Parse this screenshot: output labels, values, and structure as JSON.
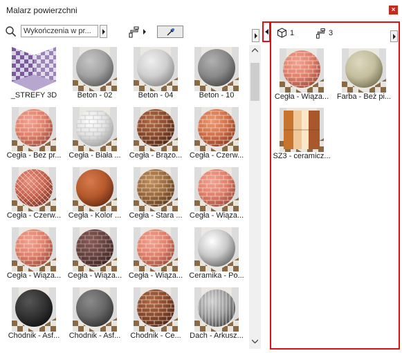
{
  "window": {
    "title": "Malarz powierzchni",
    "close_glyph": "×"
  },
  "toolbar": {
    "search_value": "Wykończenia w pr...",
    "search_icon": "search-icon",
    "brush_icon": "paint-roller-icon",
    "picker_icon": "eyedropper-icon"
  },
  "library": {
    "items": [
      {
        "label": "_STREFY 3D",
        "kind": "zones"
      },
      {
        "label": "Beton - 02",
        "kind": "concrete"
      },
      {
        "label": "Beton - 04",
        "kind": "concrete-light"
      },
      {
        "label": "Beton - 10",
        "kind": "concrete-dark"
      },
      {
        "label": "Cegła - Bez pr...",
        "kind": "brick-salmon"
      },
      {
        "label": "Cegła - Biała ...",
        "kind": "brick-white"
      },
      {
        "label": "Cegła - Brązo...",
        "kind": "brick-brown"
      },
      {
        "label": "Cegła - Czerw...",
        "kind": "brick-orange"
      },
      {
        "label": "Cegła - Czerw...",
        "kind": "herringbone"
      },
      {
        "label": "Cegła - Kolor ...",
        "kind": "rust"
      },
      {
        "label": "Cegła - Stara ...",
        "kind": "brick-old"
      },
      {
        "label": "Cegła - Wiąza...",
        "kind": "brick-salmon"
      },
      {
        "label": "Cegła - Wiąza...",
        "kind": "brick-salmon"
      },
      {
        "label": "Cegła - Wiąza...",
        "kind": "brick-dark"
      },
      {
        "label": "Cegła - Wiąza...",
        "kind": "brick-salmon"
      },
      {
        "label": "Ceramika - Po...",
        "kind": "ceramic"
      },
      {
        "label": "Chodnik - Asf...",
        "kind": "asphalt"
      },
      {
        "label": "Chodnik - Asf...",
        "kind": "asphalt-grey"
      },
      {
        "label": "Chodnik - Ce...",
        "kind": "brick-brown"
      },
      {
        "label": "Dach - Arkusz...",
        "kind": "sheet"
      }
    ]
  },
  "used_panel": {
    "surfaces_count": "1",
    "materials_count": "3",
    "cube_icon": "cube-icon",
    "brush_icon": "paint-roller-icon",
    "items": [
      {
        "label": "Cegła - Wiąza...",
        "kind": "brick-salmon"
      },
      {
        "label": "Farba - Beż pi...",
        "kind": "beige"
      },
      {
        "label": "SZ3 - ceramicz...",
        "kind": "tiles"
      }
    ]
  },
  "colors": {
    "highlight": "#e01010",
    "close": "#c42b1c",
    "scrollbar": "#cdcdcd"
  }
}
